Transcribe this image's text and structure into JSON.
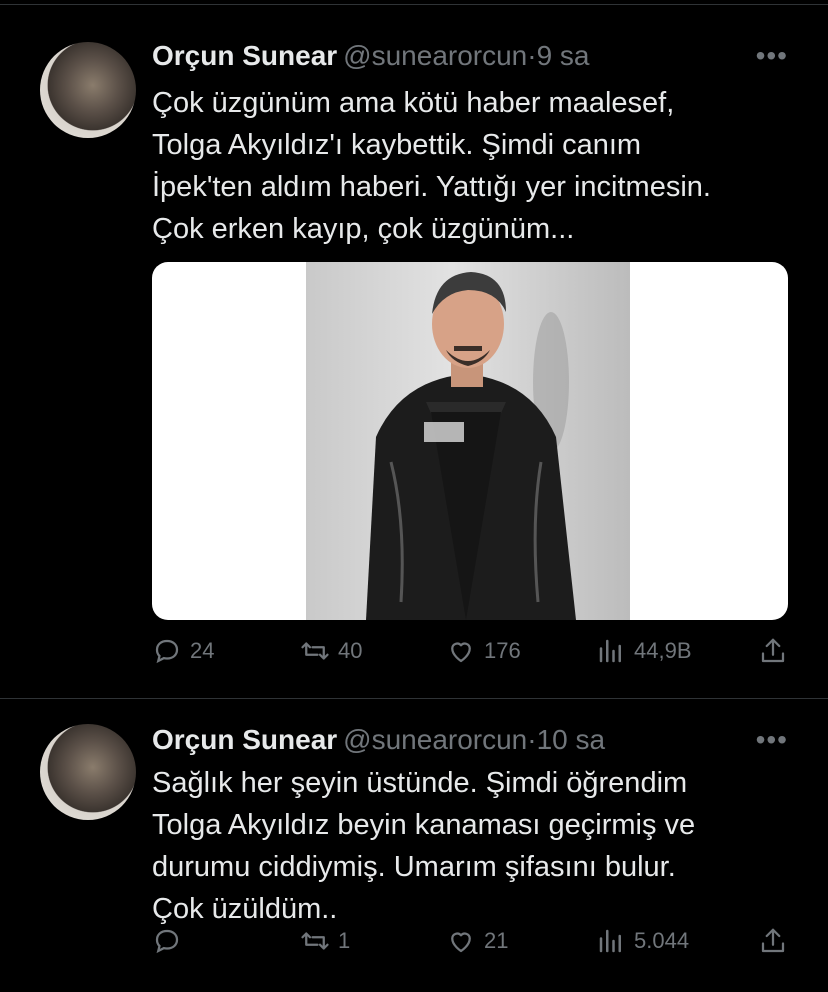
{
  "tweets": [
    {
      "name": "Orçun Sunear",
      "handle": "@sunearorcun",
      "separator": "·",
      "time": "9 sa",
      "text": "Çok üzgünüm ama kötü haber maalesef,\nTolga Akyıldız'ı kaybettik. Şimdi canım\nİpek'ten aldım haberi. Yattığı yer incitmesin.\nÇok erken kayıp, çok üzgünüm...",
      "has_media": true,
      "replies": "24",
      "retweets": "40",
      "likes": "176",
      "views": "44,9B"
    },
    {
      "name": "Orçun Sunear",
      "handle": "@sunearorcun",
      "separator": "·",
      "time": "10 sa",
      "text": "Sağlık her şeyin üstünde. Şimdi öğrendim\nTolga Akyıldız beyin kanaması geçirmiş ve\ndurumu ciddiymiş. Umarım şifasını bulur.\nÇok üzüldüm..",
      "has_media": false,
      "replies": "",
      "retweets": "1",
      "likes": "21",
      "views": "5.044"
    }
  ],
  "icons": {
    "more": "more-horizontal-icon",
    "reply": "reply-icon",
    "retweet": "retweet-icon",
    "like": "heart-icon",
    "views": "views-bar-chart-icon",
    "share": "share-icon"
  },
  "colors": {
    "background": "#000000",
    "text": "#e7e9ea",
    "secondary": "#71767b",
    "divider": "#2f3336"
  }
}
